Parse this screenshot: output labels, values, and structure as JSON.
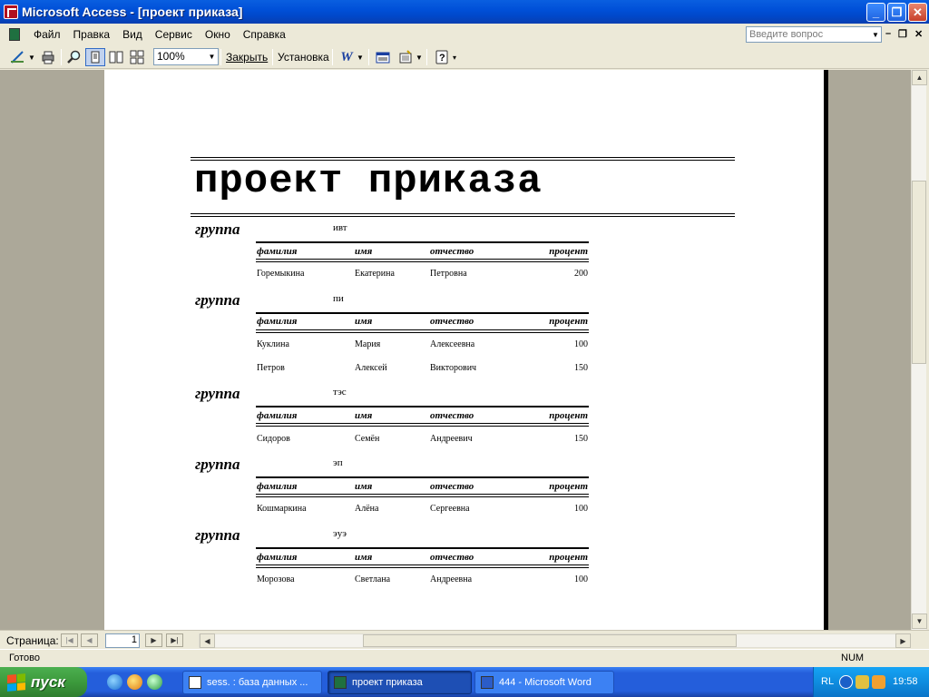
{
  "window": {
    "title": "Microsoft Access - [проект приказа]"
  },
  "menu": {
    "items": [
      "Файл",
      "Правка",
      "Вид",
      "Сервис",
      "Окно",
      "Справка"
    ],
    "help_placeholder": "Введите вопрос"
  },
  "toolbar": {
    "zoom": "100%",
    "close_label": "Закрыть",
    "setup_label": "Установка"
  },
  "report": {
    "title": "проект приказа",
    "group_label": "группа",
    "headers": {
      "surname": "фамилия",
      "name": "имя",
      "patronymic": "отчество",
      "percent": "процент"
    },
    "groups": [
      {
        "name": "ивт",
        "rows": [
          {
            "surname": "Горемыкина",
            "name": "Екатерина",
            "patronymic": "Петровна",
            "percent": "200"
          }
        ]
      },
      {
        "name": "пи",
        "rows": [
          {
            "surname": "Куклина",
            "name": "Мария",
            "patronymic": "Алексеевна",
            "percent": "100"
          },
          {
            "surname": "Петров",
            "name": "Алексей",
            "patronymic": "Викторович",
            "percent": "150"
          }
        ]
      },
      {
        "name": "тэс",
        "rows": [
          {
            "surname": "Сидоров",
            "name": "Семён",
            "patronymic": "Андреевич",
            "percent": "150"
          }
        ]
      },
      {
        "name": "эп",
        "rows": [
          {
            "surname": "Кошмаркина",
            "name": "Алёна",
            "patronymic": "Сергеевна",
            "percent": "100"
          }
        ]
      },
      {
        "name": "эуэ",
        "rows": [
          {
            "surname": "Морозова",
            "name": "Светлана",
            "patronymic": "Андреевна",
            "percent": "100"
          }
        ]
      }
    ]
  },
  "navigation": {
    "page_label": "Страница:",
    "page_number": "1"
  },
  "status": {
    "text": "Готово",
    "num": "NUM"
  },
  "taskbar": {
    "start_label": "пуск",
    "tasks": [
      {
        "label": "sess. : база данных ...",
        "active": false
      },
      {
        "label": "проект приказа",
        "active": true
      },
      {
        "label": "444 - Microsoft Word",
        "active": false
      }
    ],
    "lang": "RL",
    "clock": "19:58"
  },
  "colors": {
    "titlebar": "#0050d8",
    "taskbar": "#245edb",
    "start": "#3c9a3c",
    "workarea": "#aca899"
  }
}
